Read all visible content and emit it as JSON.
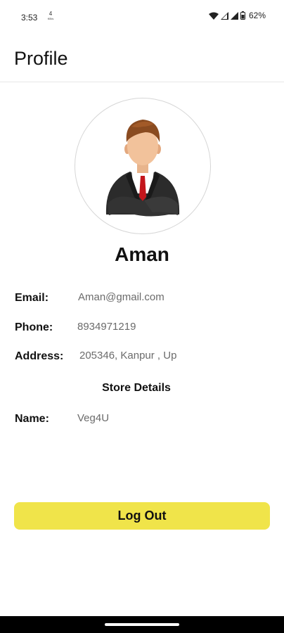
{
  "status_bar": {
    "time": "3:53",
    "network_speed_value": "4",
    "network_speed_unit": "KB/s",
    "battery_percent": "62%"
  },
  "header": {
    "title": "Profile"
  },
  "profile": {
    "name": "Aman",
    "fields": [
      {
        "label": "Email:",
        "value": "Aman@gmail.com"
      },
      {
        "label": "Phone:",
        "value": "8934971219"
      },
      {
        "label": "Address:",
        "value": "205346, Kanpur , Up"
      }
    ]
  },
  "store": {
    "section_title": "Store Details",
    "fields": [
      {
        "label": "Name:",
        "value": "Veg4U"
      }
    ]
  },
  "actions": {
    "logout_label": "Log Out"
  },
  "colors": {
    "accent": "#f0e44a",
    "value_text": "#6b6b6b",
    "divider": "#e6e6e6"
  }
}
